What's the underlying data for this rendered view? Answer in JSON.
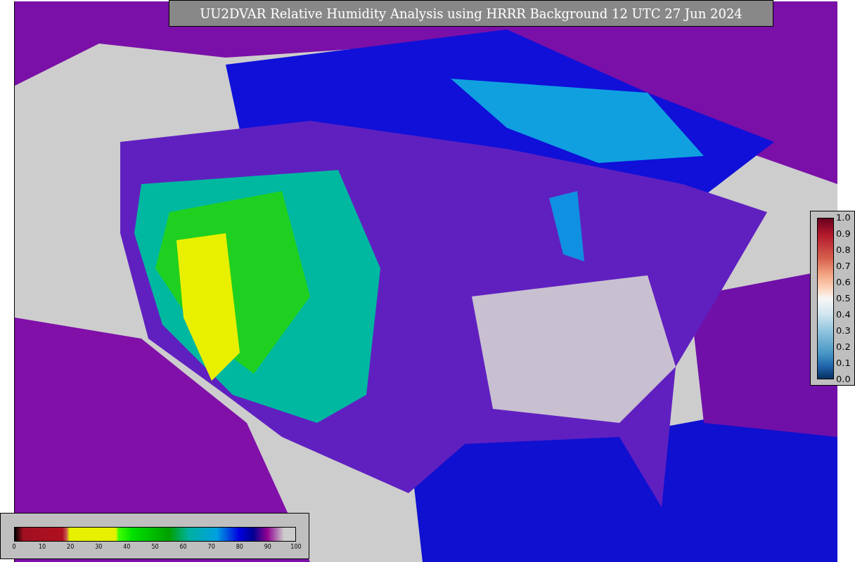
{
  "title": "UU2DVAR Relative Humidity Analysis using HRRR Background 12 UTC 27 Jun 2024",
  "ratio_colorbar": {
    "ticks": [
      "1.0",
      "0.9",
      "0.8",
      "0.7",
      "0.6",
      "0.5",
      "0.4",
      "0.3",
      "0.2",
      "0.1",
      "0.0"
    ]
  },
  "humidity_colorbar": {
    "ticks": [
      "0",
      "10",
      "20",
      "30",
      "40",
      "50",
      "60",
      "70",
      "80",
      "90",
      "100"
    ]
  }
}
